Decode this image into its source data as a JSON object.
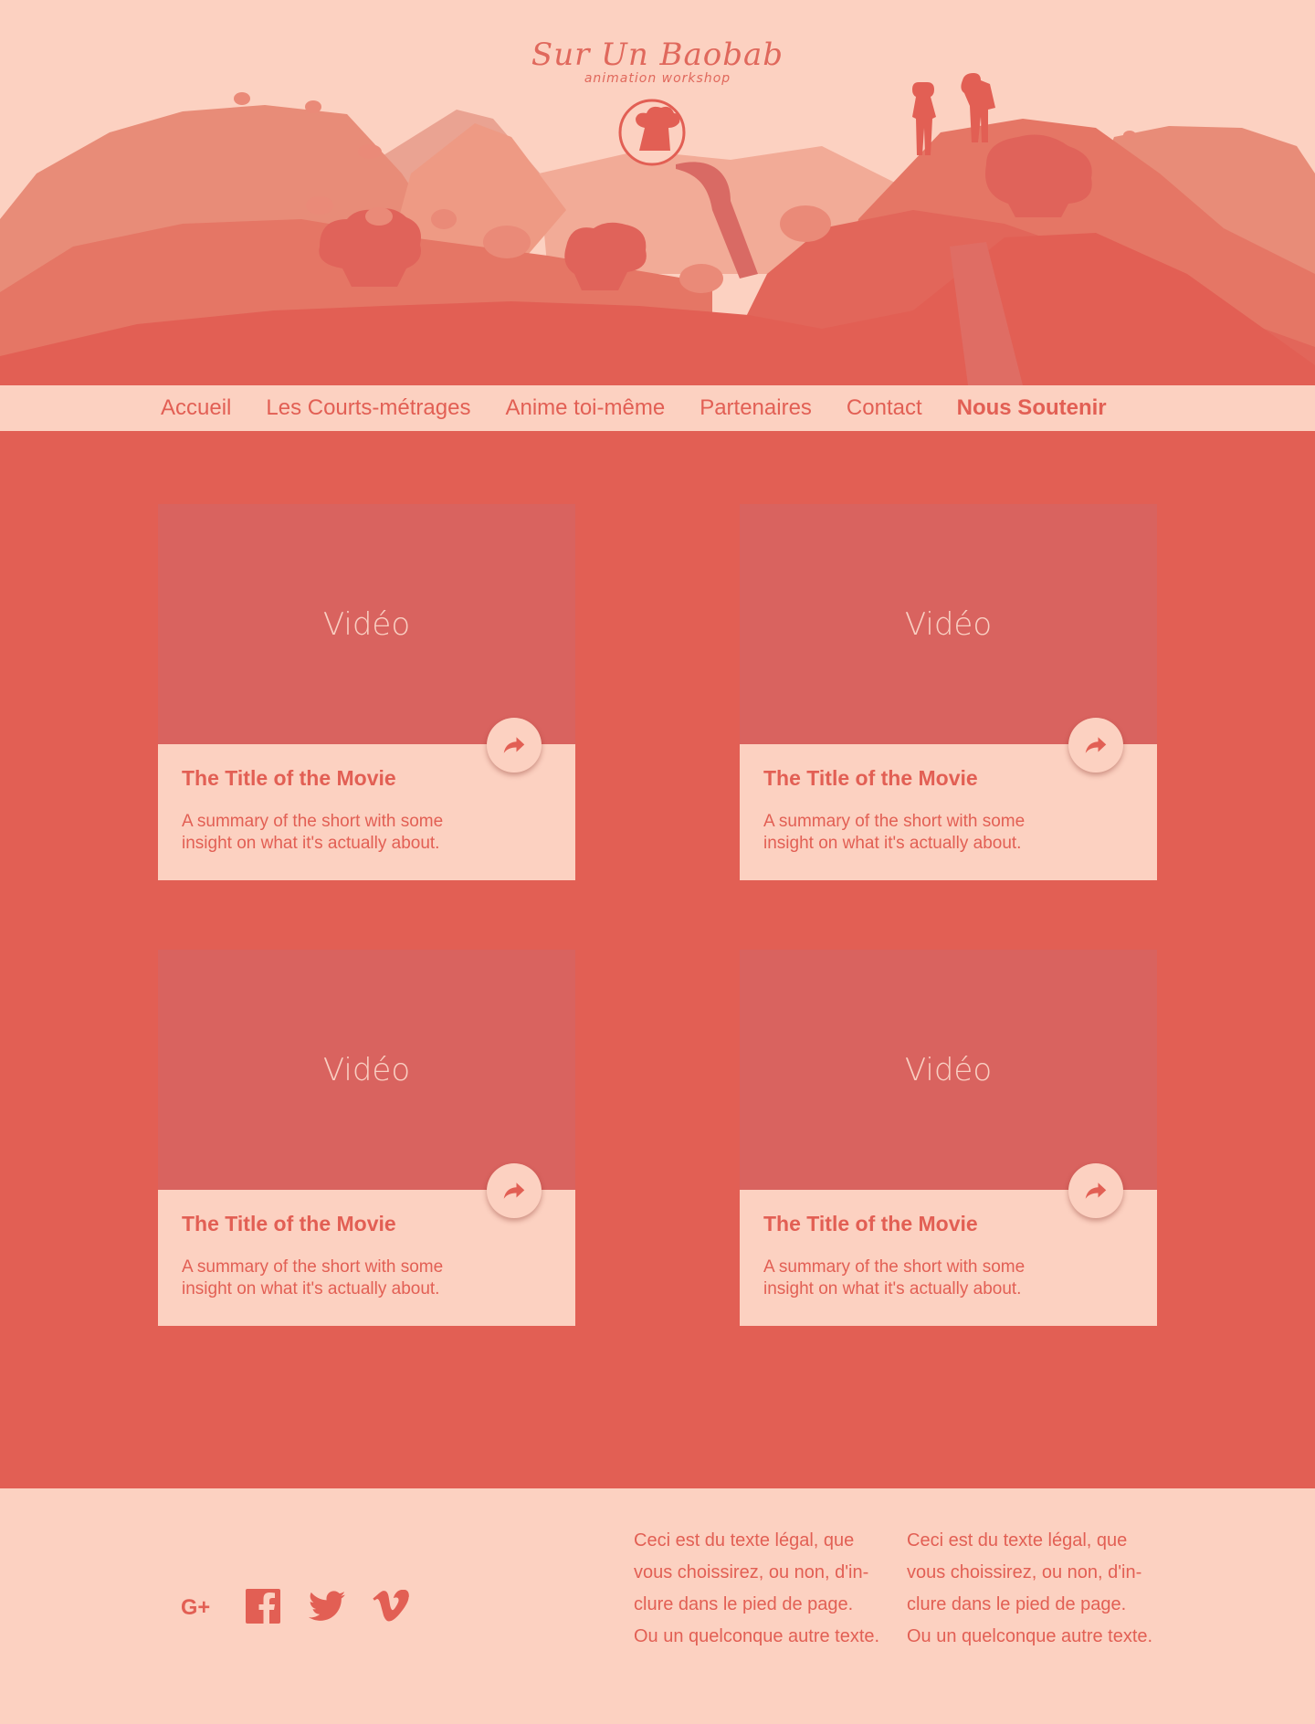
{
  "brand": {
    "name": "Sur Un Baobab",
    "tagline": "animation workshop"
  },
  "nav": {
    "items": [
      "Accueil",
      "Les Courts-métrages",
      "Anime toi-même",
      "Partenaires",
      "Contact"
    ],
    "highlight": "Nous Soutenir"
  },
  "cards": [
    {
      "video_label": "Vidéo",
      "title": "The Title of the Movie",
      "summary": "A summary of the short with some insight on what it's actually about."
    },
    {
      "video_label": "Vidéo",
      "title": "The Title of the Movie",
      "summary": "A summary of the short with some insight on what it's actually about."
    },
    {
      "video_label": "Vidéo",
      "title": "The Title of the Movie",
      "summary": "A summary of the short with some insight on what it's actually about."
    },
    {
      "video_label": "Vidéo",
      "title": "The Title of the Movie",
      "summary": "A summary of the short with some insight on what it's actually about."
    }
  ],
  "footer": {
    "social": [
      "google-plus-icon",
      "facebook-icon",
      "twitter-icon",
      "vimeo-icon"
    ],
    "legal": [
      "Ceci est du texte légal, que vous choissirez, ou non, d'in-clure dans le pied de page. Ou un quelconque autre texte.",
      "Ceci est du texte légal, que vous choissirez, ou non, d'in-clure dans le pied de page. Ou un quelconque autre texte."
    ]
  },
  "colors": {
    "background": "#fcd1c1",
    "accent": "#e25f54",
    "video_panel": "#d9635f"
  }
}
